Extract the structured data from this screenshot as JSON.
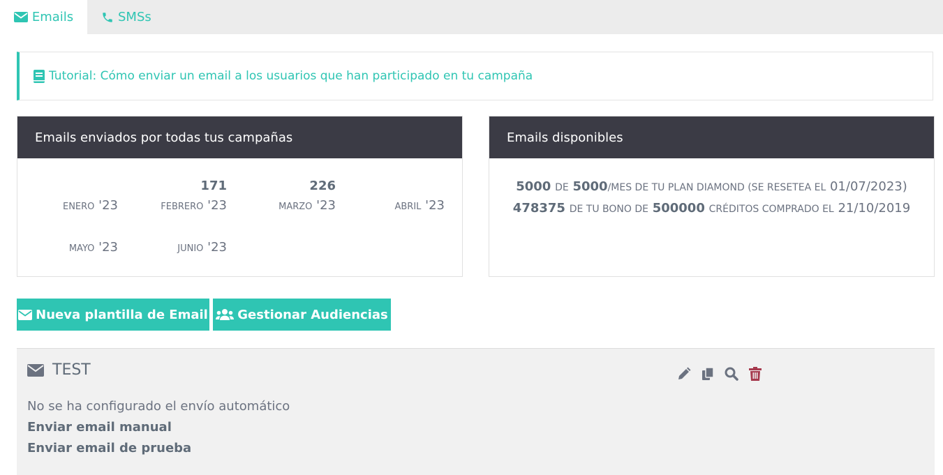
{
  "tabs": [
    {
      "label": "Emails",
      "icon": "envelope-icon",
      "active": true
    },
    {
      "label": "SMSs",
      "icon": "phone-icon",
      "active": false
    }
  ],
  "tutorial": {
    "icon": "book-icon",
    "text": "Tutorial: Cómo enviar un email a los usuarios que han participado en tu campaña"
  },
  "sent_panel": {
    "title": "Emails enviados por todas tus campañas",
    "months": [
      {
        "value": "",
        "label_small": "Enero",
        "label_year": "'23"
      },
      {
        "value": "171",
        "label_small": "Febrero",
        "label_year": "'23"
      },
      {
        "value": "226",
        "label_small": "Marzo",
        "label_year": "'23"
      },
      {
        "value": "",
        "label_small": "Abril",
        "label_year": "'23"
      },
      {
        "value": "",
        "label_small": "Mayo",
        "label_year": "'23"
      },
      {
        "value": "",
        "label_small": "Junio",
        "label_year": "'23"
      }
    ]
  },
  "avail_panel": {
    "title": "Emails disponibles",
    "line1": {
      "n1": "5000",
      "t1": "de",
      "n2": "5000",
      "t2": "/mes de tu plan Diamond (se resetea el",
      "date": "01/07/2023)"
    },
    "line2": {
      "n1": "478375",
      "t1": "de tu bono de",
      "n2": "500000",
      "t2": "créditos comprado el",
      "date": "21/10/2019"
    }
  },
  "buttons": {
    "new_template": "Nueva plantilla de Email",
    "audiences": "Gestionar Audiencias"
  },
  "card": {
    "title": "TEST",
    "no_auto": "No se ha configurado el envío automático",
    "manual": "Enviar email manual",
    "test": "Enviar email de prueba"
  },
  "colors": {
    "accent": "#2fc5b3",
    "header": "#3b3b45",
    "danger": "#a63a4e",
    "icon": "#6b7280"
  }
}
